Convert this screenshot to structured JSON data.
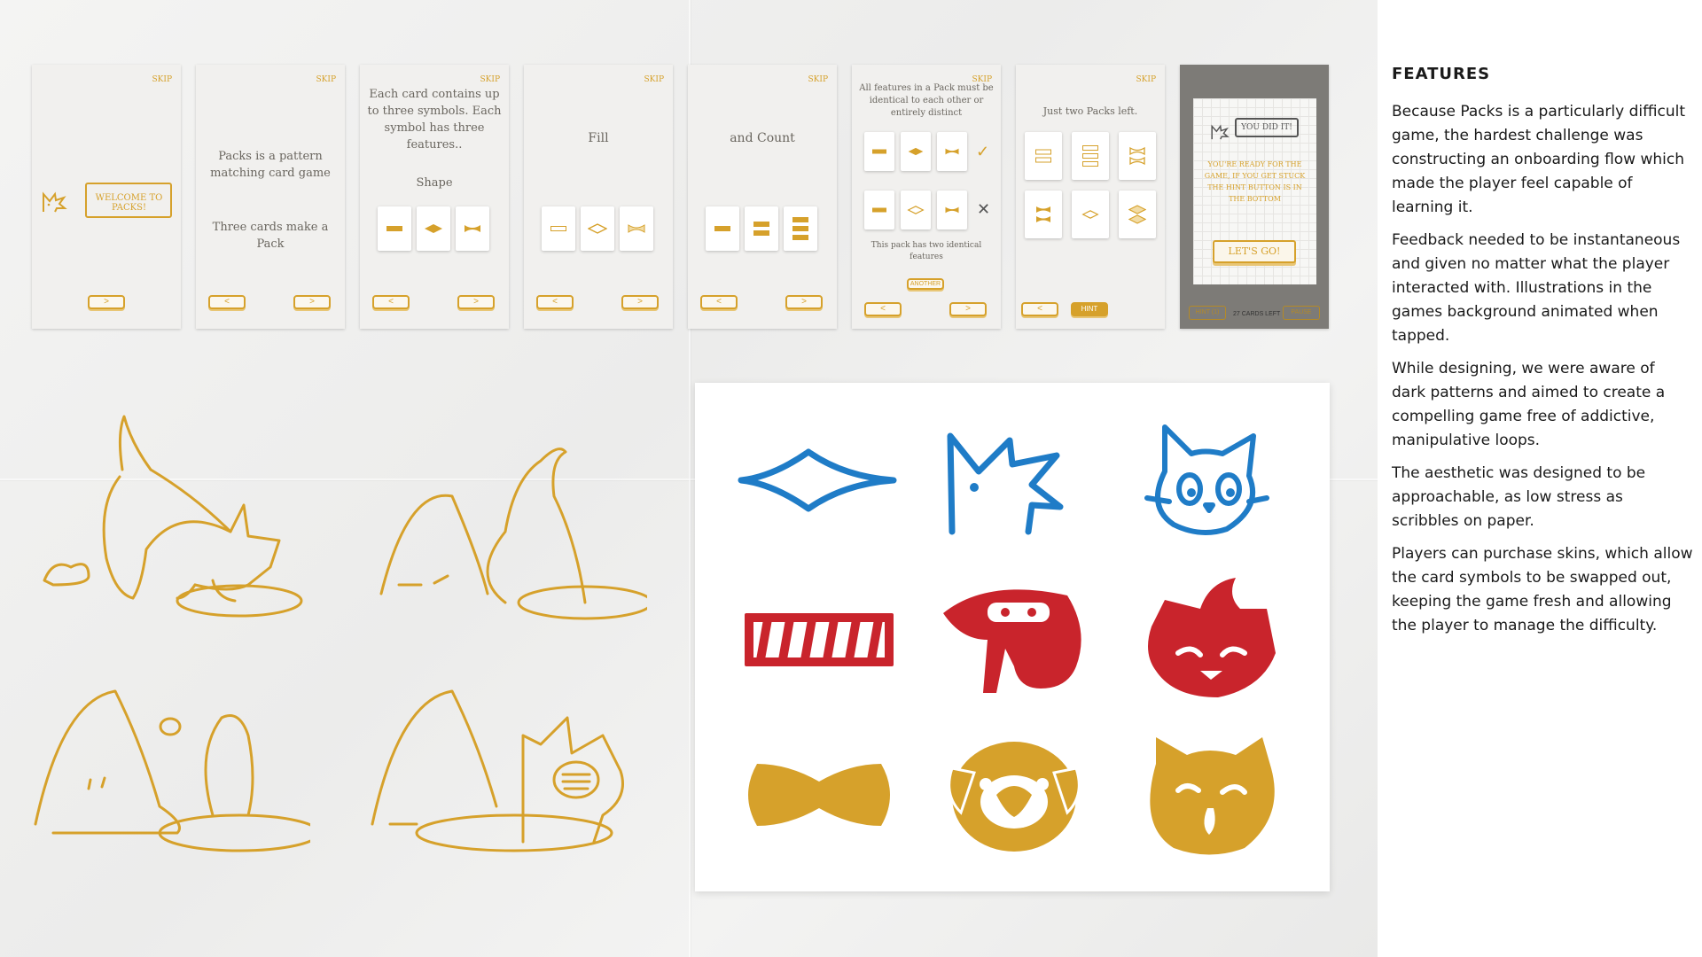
{
  "screens": [
    {
      "skip": "SKIP",
      "bubble": "WELCOME TO PACKS!",
      "next": ">"
    },
    {
      "skip": "SKIP",
      "text1": "Packs is a pattern matching card game",
      "text2": "Three cards make a Pack",
      "prev": "<",
      "next": ">"
    },
    {
      "skip": "SKIP",
      "text1": "Each card contains up to three symbols. Each symbol has three features..",
      "label": "Shape",
      "prev": "<",
      "next": ">"
    },
    {
      "skip": "SKIP",
      "text1": "Fill",
      "prev": "<",
      "next": ">"
    },
    {
      "skip": "SKIP",
      "text1": "and Count",
      "prev": "<",
      "next": ">"
    },
    {
      "skip": "SKIP",
      "text1": "All features in a Pack must be identical to each other or entirely distinct",
      "check": "✓",
      "cross": "✕",
      "text2": "This pack has two identical features",
      "another": "ANOTHER",
      "prev": "<",
      "next": ">"
    },
    {
      "skip": "SKIP",
      "text1": "Just two Packs left.",
      "prev": "<",
      "hint": "HINT"
    },
    {
      "bubble": "YOU DID IT!",
      "text1": "YOU'RE READY FOR THE GAME, IF YOU GET STUCK THE HINT BUTTON IS IN THE BOTTOM",
      "cta": "LET'S GO!",
      "hint_btn": "HINT (1)",
      "cards_left": "27 CARDS LEFT",
      "pause": "PAUSE"
    }
  ],
  "colors": {
    "accent": "#d6a12b",
    "blue": "#1f7cc7",
    "red": "#c9242c",
    "ink": "#1a1a1a"
  },
  "icons": [
    "diamond-icon",
    "spiky-cat-icon",
    "cat-face-icon",
    "bar-pattern-icon",
    "bird-icon",
    "grumpy-cat-icon",
    "bowtie-icon",
    "pug-icon",
    "happy-cat-icon"
  ],
  "features": {
    "heading": "FEATURES",
    "paragraphs": [
      "Because Packs is a particularly difficult game, the hardest challenge was constructing an onboarding flow which made the player feel capable of learning it.",
      "Feedback needed to be instantaneous and given no matter what the player interacted with. Illustrations in the games background animated when tapped.",
      "While designing, we were aware of dark patterns and aimed to create a compelling game free of addictive, manipulative loops.",
      "The aesthetic was designed to be approachable, as low stress as scribbles on paper.",
      "Players can purchase skins, which allow the card symbols to be swapped out, keeping the game fresh and allowing the player to manage the difficulty."
    ]
  }
}
